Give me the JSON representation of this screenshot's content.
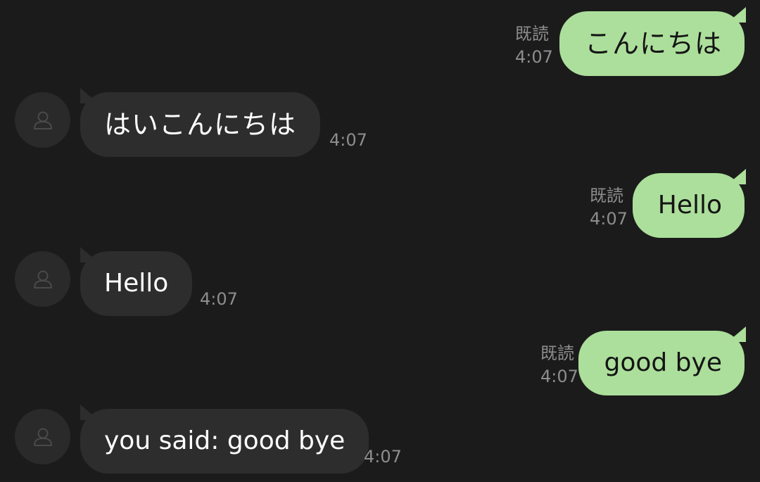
{
  "colors": {
    "background": "#1b1b1b",
    "outgoing_bubble": "#acdf9b",
    "incoming_bubble": "#2d2d2d",
    "meta_text": "#8d8d8d"
  },
  "messages": [
    {
      "direction": "outgoing",
      "text": "こんにちは",
      "read_label": "既読",
      "time": "4:07"
    },
    {
      "direction": "incoming",
      "text": "はいこんにちは",
      "time": "4:07",
      "avatar_icon": "default-user-icon"
    },
    {
      "direction": "outgoing",
      "text": "Hello",
      "read_label": "既読",
      "time": "4:07"
    },
    {
      "direction": "incoming",
      "text": "Hello",
      "time": "4:07",
      "avatar_icon": "default-user-icon"
    },
    {
      "direction": "outgoing",
      "text": "good bye",
      "read_label": "既読",
      "time": "4:07"
    },
    {
      "direction": "incoming",
      "text": "you said: good bye",
      "time": "4:07",
      "avatar_icon": "default-user-icon"
    }
  ]
}
